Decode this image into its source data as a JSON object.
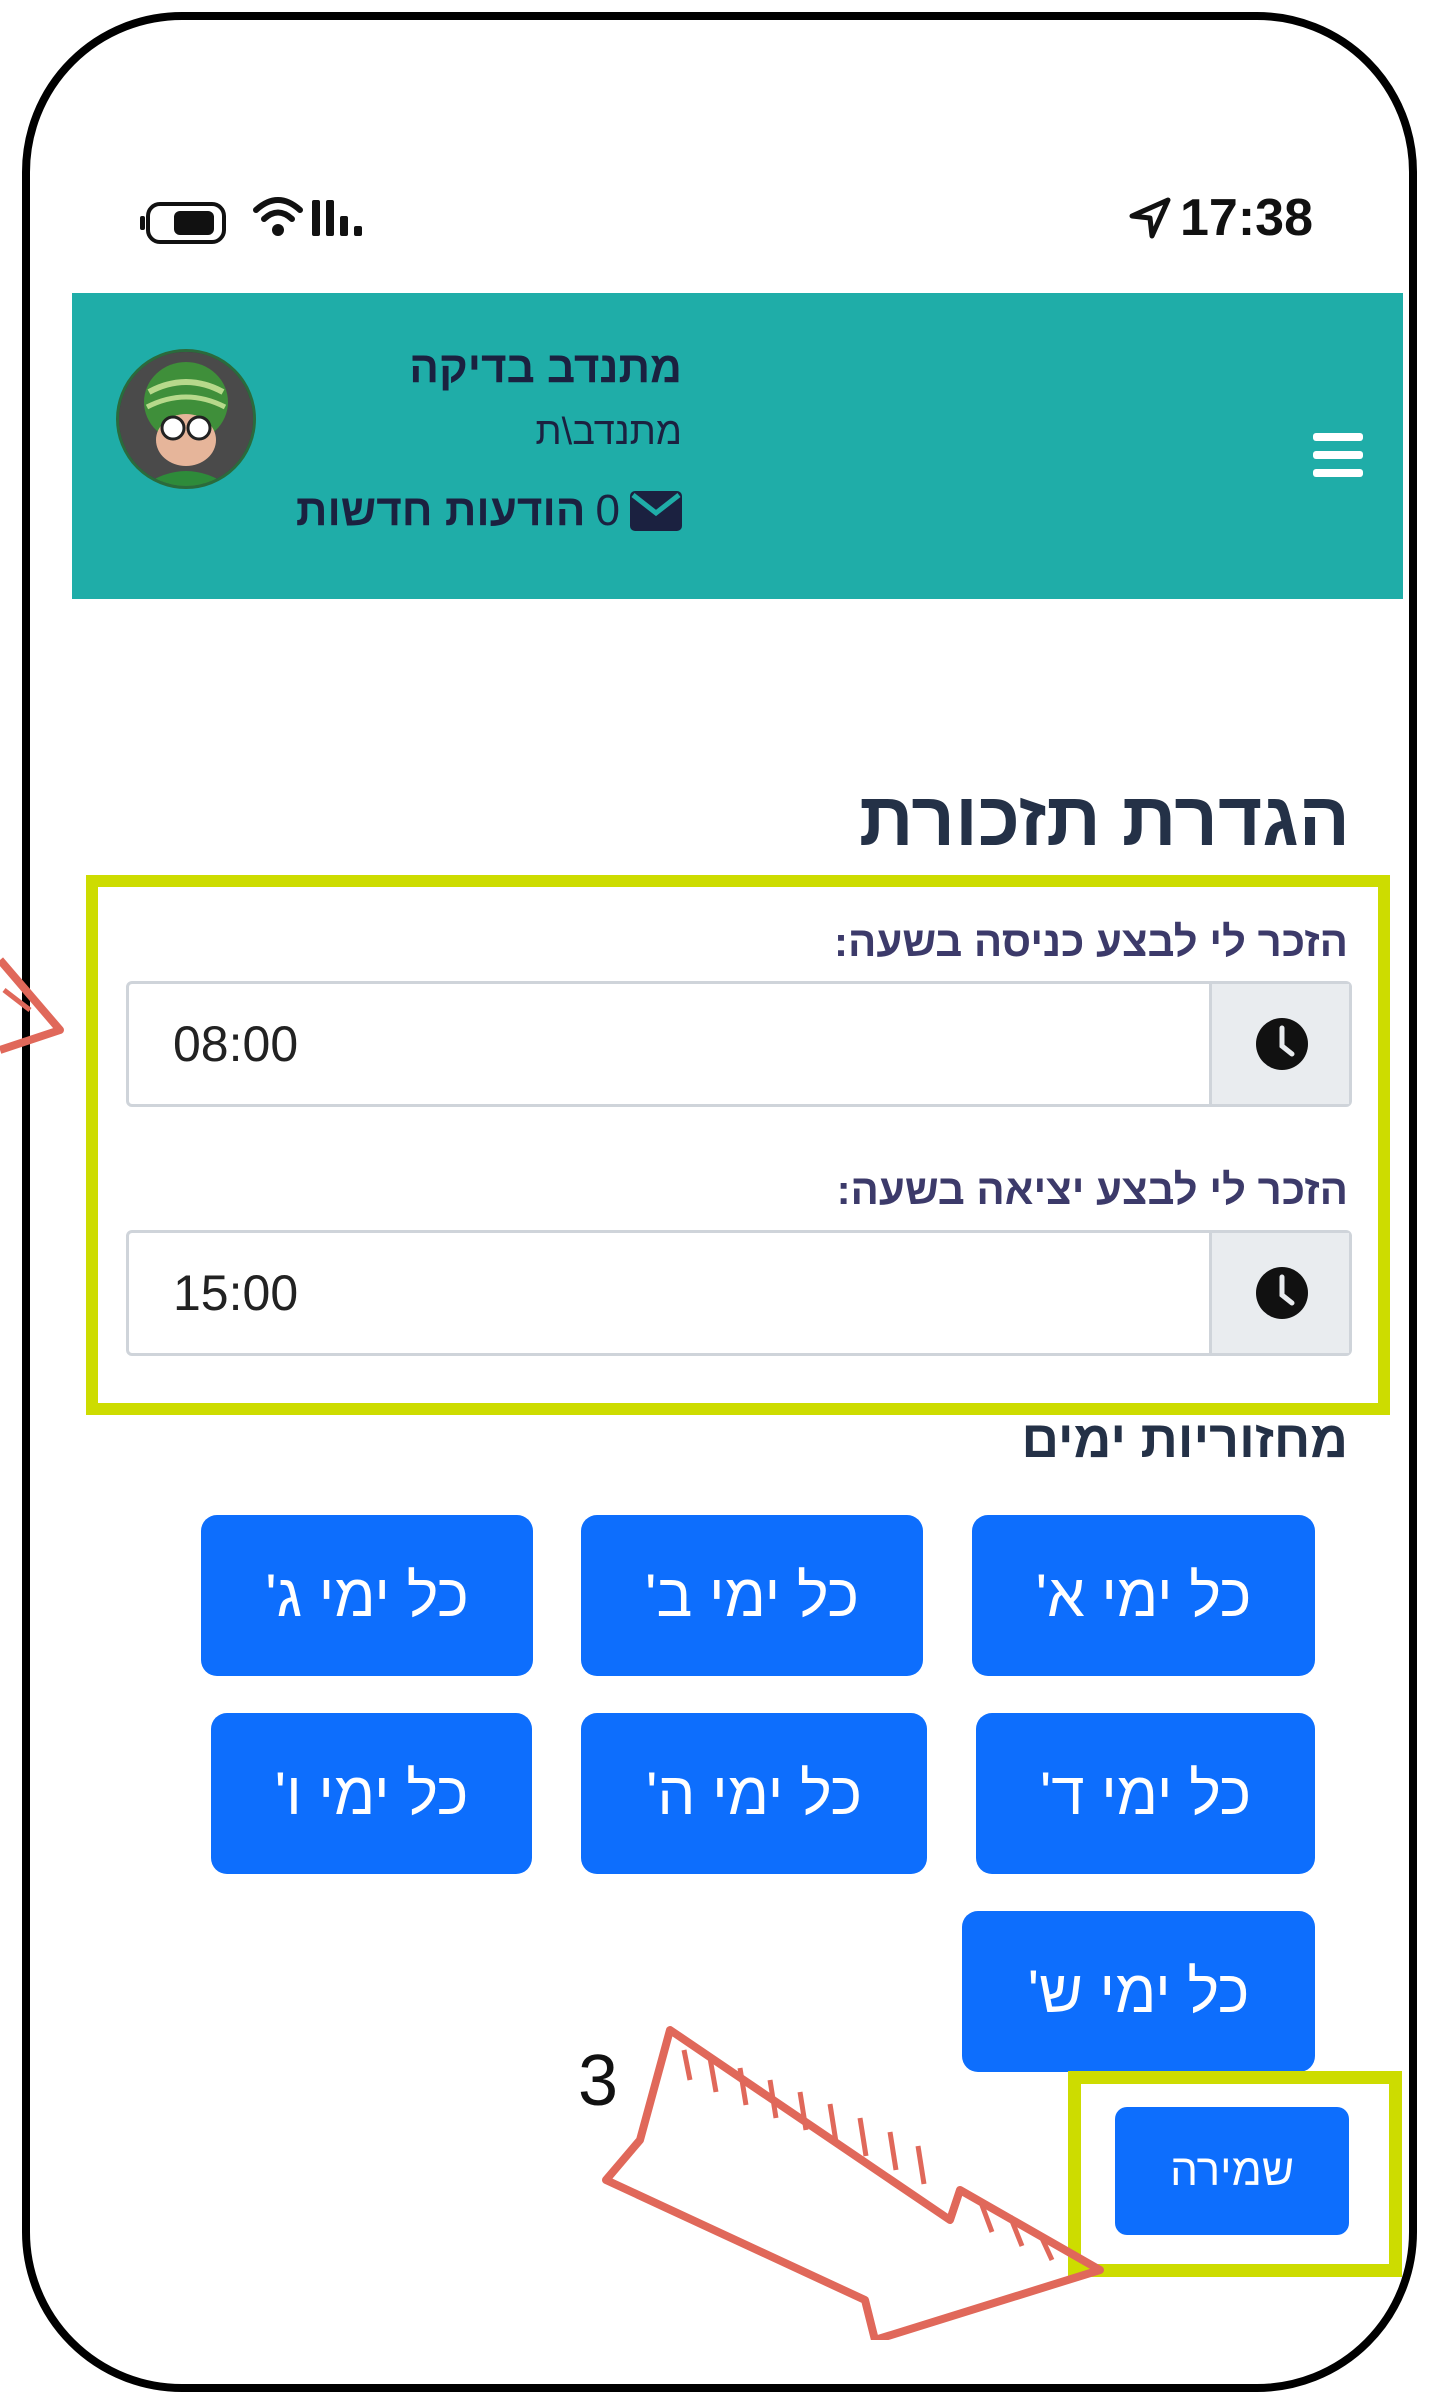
{
  "status_bar": {
    "time": "17:38",
    "icons": [
      "location-arrow-icon",
      "battery-icon",
      "wifi-icon",
      "signal-icon"
    ]
  },
  "header": {
    "user_name": "מתנדב בדיקה",
    "user_role": "מתנדב\\ת",
    "messages_count": "0",
    "messages_label": "הודעות חדשות",
    "menu_icon": "hamburger-icon",
    "mail_icon": "envelope-icon",
    "background_color": "#1fada8"
  },
  "page": {
    "title": "הגדרת תזכורת",
    "checkin_label": "הזכר לי לבצע כניסה בשעה:",
    "checkin_value": "08:00",
    "checkout_label": "הזכר לי לבצע יציאה בשעה:",
    "checkout_value": "15:00",
    "days_title": "מחזוריות ימים",
    "days": [
      "כל ימי א'",
      "כל ימי ב'",
      "כל ימי ג'",
      "כל ימי ד'",
      "כל ימי ה'",
      "כל ימי ו'",
      "כל ימי ש'"
    ],
    "save_label": "שמירה"
  },
  "annotation": {
    "step_number": "3",
    "highlight_color": "#cddc00",
    "arrow_color": "#e0685a"
  },
  "accent_color": "#0d6efd"
}
